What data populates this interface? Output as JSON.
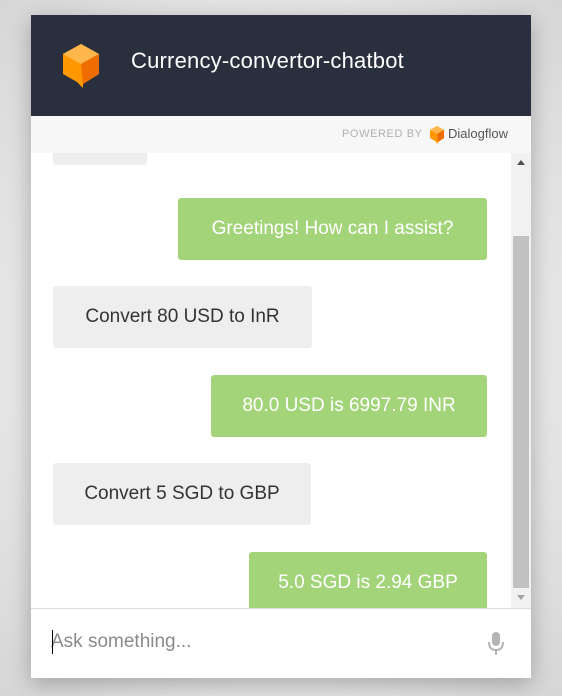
{
  "header": {
    "title": "Currency-convertor-chatbot",
    "logo_icon": "dialogflow-agent-logo-icon",
    "colors": {
      "background": "#2a2f3e",
      "logo": "#ff9800"
    }
  },
  "powered_by": {
    "label": "POWERED BY",
    "brand": "Dialogflow",
    "brand_icon": "dialogflow-icon"
  },
  "messages": [
    {
      "sender": "bot",
      "text": "Greetings! How can I assist?"
    },
    {
      "sender": "user",
      "text": "Convert 80 USD to InR"
    },
    {
      "sender": "bot",
      "text": "80.0 USD is 6997.79 INR"
    },
    {
      "sender": "user",
      "text": "Convert 5 SGD to GBP"
    },
    {
      "sender": "bot",
      "text": "5.0 SGD is 2.94 GBP"
    }
  ],
  "input": {
    "placeholder": "Ask something...",
    "value": "",
    "mic_icon": "microphone-icon"
  },
  "colors": {
    "bot_bubble": "#a3d47a",
    "user_bubble": "#eeeeee"
  }
}
